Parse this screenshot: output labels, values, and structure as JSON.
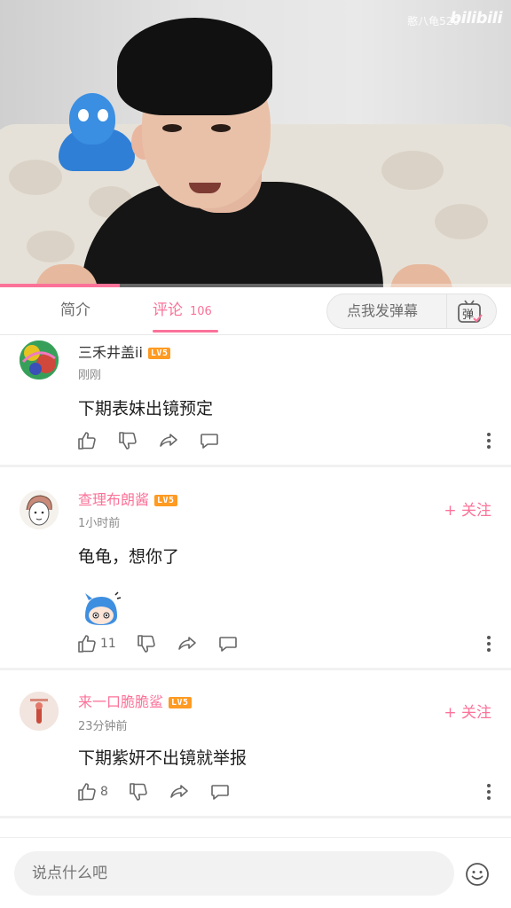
{
  "video": {
    "watermark_text": "憨八龟520",
    "watermark_logo": "bilibili",
    "progress": 0.235
  },
  "tabs": {
    "intro_label": "简介",
    "comments_label": "评论",
    "comments_count": "106",
    "danmaku_placeholder": "点我发弹幕",
    "danmaku_icon_char": "弹"
  },
  "comments": [
    {
      "username": "三禾井盖ii",
      "level": "LV5",
      "time": "刚刚",
      "text": "下期表妹出镜预定",
      "likes": "",
      "follow": ""
    },
    {
      "username": "查理布朗酱",
      "level": "LV5",
      "time": "1小时前",
      "text": "龟龟，想你了",
      "likes": "11",
      "follow": "+ 关注"
    },
    {
      "username": "来一口脆脆鲨",
      "level": "LV5",
      "time": "23分钟前",
      "text": "下期紫妍不出镜就举报",
      "likes": "8",
      "follow": "+ 关注"
    }
  ],
  "input": {
    "placeholder": "说点什么吧"
  },
  "colors": {
    "accent": "#fb7299",
    "level_badge": "#ff9a22"
  }
}
